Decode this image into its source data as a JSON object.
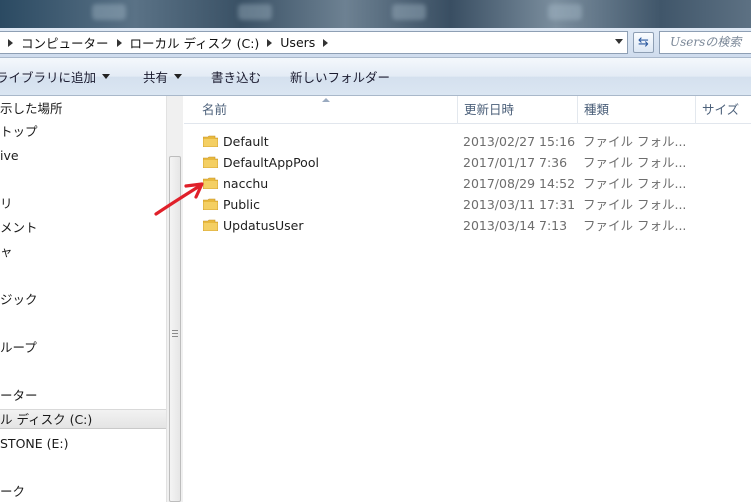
{
  "address": {
    "crumbs": [
      "コンピューター",
      "ローカル ディスク (C:)",
      "Users"
    ]
  },
  "search": {
    "placeholder": "Usersの検索"
  },
  "toolbar": {
    "library_label": "ライブラリに追加",
    "share_label": "共有",
    "burn_label": "書き込む",
    "new_folder_label": "新しいフォルダー"
  },
  "nav": {
    "items": [
      "示した場所",
      "トップ",
      "ive",
      "リ",
      "メント",
      "ャ",
      "ジック",
      "ループ",
      "ーター",
      "ル ディスク (C:)",
      "STONE (E:)",
      "ーク"
    ],
    "selected_index": 9
  },
  "columns": {
    "name": "名前",
    "date": "更新日時",
    "type": "種類",
    "size": "サイズ"
  },
  "rows": [
    {
      "name": "Default",
      "date": "2013/02/27 15:16",
      "type": "ファイル フォル..."
    },
    {
      "name": "DefaultAppPool",
      "date": "2017/01/17 7:36",
      "type": "ファイル フォル..."
    },
    {
      "name": "nacchu",
      "date": "2017/08/29 14:52",
      "type": "ファイル フォル..."
    },
    {
      "name": "Public",
      "date": "2013/03/11 17:31",
      "type": "ファイル フォル..."
    },
    {
      "name": "UpdatusUser",
      "date": "2013/03/14 7:13",
      "type": "ファイル フォル..."
    }
  ],
  "colors": {
    "folder": "#e8b93e",
    "annotation_arrow": "#e0202a",
    "header_text": "#4c607a"
  }
}
